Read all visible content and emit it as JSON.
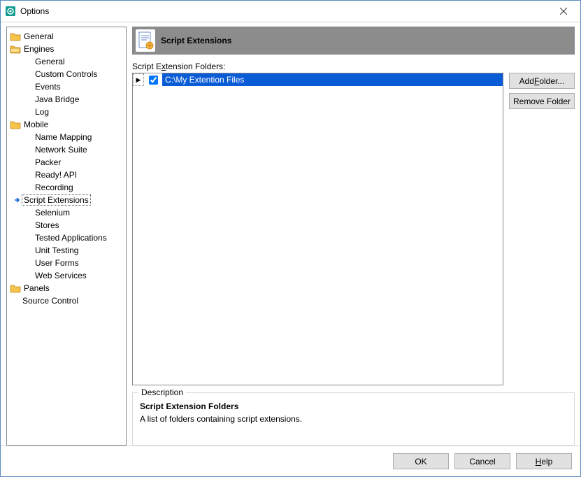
{
  "window": {
    "title": "Options"
  },
  "tree": {
    "general": "General",
    "engines": "Engines",
    "engines_children": {
      "general": "General",
      "custom_controls": "Custom Controls",
      "events": "Events",
      "java_bridge": "Java Bridge",
      "log": "Log",
      "mobile": "Mobile",
      "name_mapping": "Name Mapping",
      "network_suite": "Network Suite",
      "packer": "Packer",
      "ready_api": "Ready! API",
      "recording": "Recording",
      "script_extensions": "Script Extensions",
      "selenium": "Selenium",
      "stores": "Stores",
      "tested_applications": "Tested Applications",
      "unit_testing": "Unit Testing",
      "user_forms": "User Forms",
      "web_services": "Web Services"
    },
    "panels": "Panels",
    "source_control": "Source Control"
  },
  "header": {
    "title": "Script Extensions"
  },
  "folders": {
    "label_pre": "Script E",
    "label_u": "x",
    "label_post": "tension Folders:",
    "items": [
      {
        "checked": true,
        "path": "C:\\My Extention Files"
      }
    ]
  },
  "buttons": {
    "add_pre": "Add ",
    "add_u": "F",
    "add_post": "older...",
    "remove": "Remove Folder",
    "ok": "OK",
    "cancel": "Cancel",
    "help_u": "H",
    "help_post": "elp"
  },
  "description": {
    "legend": "Description",
    "title": "Script Extension Folders",
    "text": "A list of folders containing script extensions."
  }
}
